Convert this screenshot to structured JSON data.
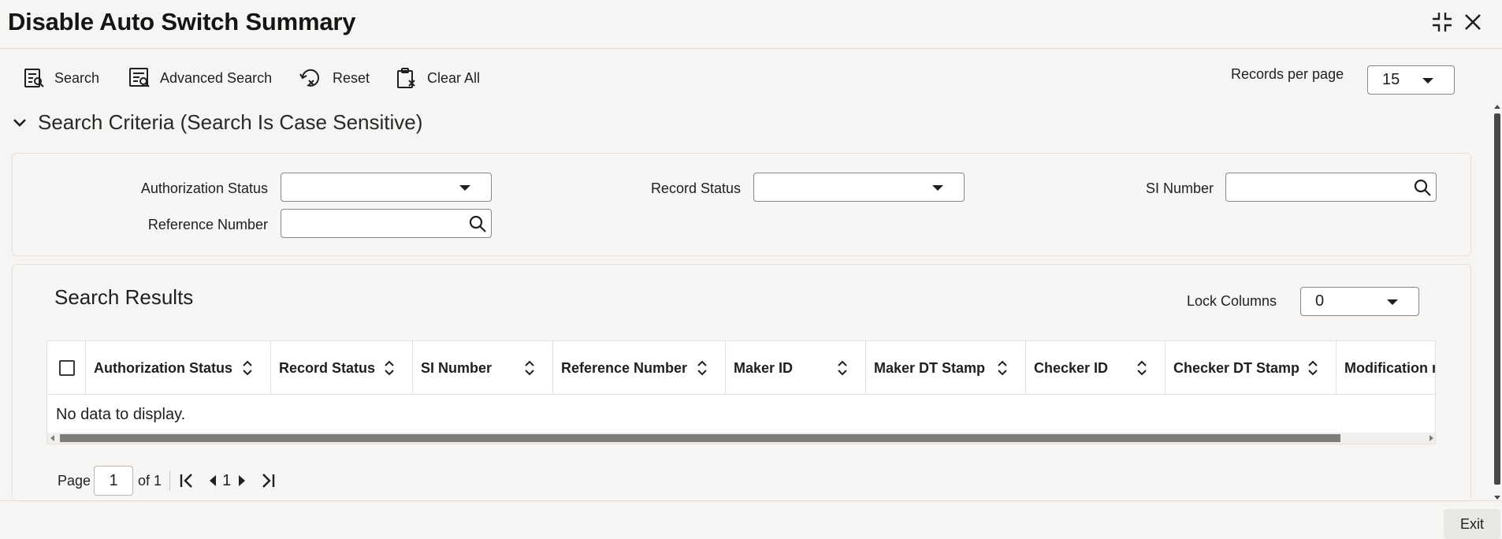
{
  "window": {
    "title": "Disable Auto Switch Summary"
  },
  "toolbar": {
    "search_label": "Search",
    "advanced_search_label": "Advanced Search",
    "reset_label": "Reset",
    "clear_all_label": "Clear All",
    "records_per_page_label": "Records per page",
    "records_per_page_value": "15"
  },
  "criteria": {
    "heading": "Search Criteria (Search Is Case Sensitive)",
    "authorization_status_label": "Authorization Status",
    "authorization_status_value": "",
    "record_status_label": "Record Status",
    "record_status_value": "",
    "si_number_label": "SI Number",
    "si_number_value": "",
    "reference_number_label": "Reference Number",
    "reference_number_value": ""
  },
  "results": {
    "heading": "Search Results",
    "lock_columns_label": "Lock Columns",
    "lock_columns_value": "0",
    "columns": [
      "Authorization Status",
      "Record Status",
      "SI Number",
      "Reference Number",
      "Maker ID",
      "Maker DT Stamp",
      "Checker ID",
      "Checker DT Stamp",
      "Modification n"
    ],
    "empty_message": "No data to display."
  },
  "pagination": {
    "page_label": "Page",
    "current_page": "1",
    "of_label": "of 1",
    "page_number": "1"
  },
  "footer": {
    "exit_label": "Exit"
  },
  "icons": {
    "search": "search-icon",
    "advanced_search": "advanced-search-icon",
    "reset": "reset-icon",
    "clear_all": "clear-all-icon",
    "minimize": "minimize-icon",
    "close": "close-icon",
    "chevron": "chevron-down-icon",
    "sort": "sort-icon",
    "first": "first-page-icon",
    "prev": "previous-page-icon",
    "next": "next-page-icon",
    "last": "last-page-icon"
  }
}
